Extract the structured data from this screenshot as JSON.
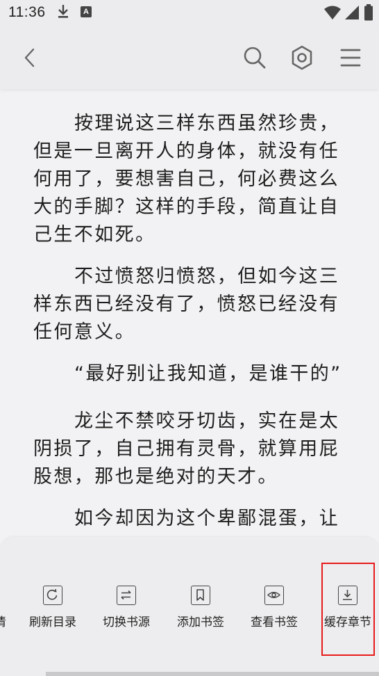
{
  "status_bar": {
    "time": "11:36",
    "app_badge": "A"
  },
  "toolbar": {
    "back": "back-icon",
    "search": "search-icon",
    "settings": "settings-icon",
    "menu": "menu-icon"
  },
  "content": {
    "paragraphs": [
      "按理说这三样东西虽然珍贵，但是一旦离开人的身体，就没有任何用了，要想害自己，何必费这么大的手脚？这样的手段，简直让自己生不如死。",
      "不过愤怒归愤怒，但如今这三样东西已经没有了，愤怒已经没有任何意义。",
      "“最好别让我知道，是谁干的”",
      "龙尘不禁咬牙切齿，实在是太阴损了，自己拥有灵骨，就算用屁股想，那也是绝对的天才。",
      "如今却因为这个卑鄙混蛋，让"
    ]
  },
  "bottom_menu": {
    "partial_label": "清",
    "items": [
      {
        "label": "刷新目录",
        "icon": "refresh-icon"
      },
      {
        "label": "切换书源",
        "icon": "swap-icon"
      },
      {
        "label": "添加书签",
        "icon": "bookmark-icon"
      },
      {
        "label": "查看书签",
        "icon": "eye-icon"
      },
      {
        "label": "缓存章节",
        "icon": "download-icon"
      }
    ]
  },
  "colors": {
    "background": "#f2f2f4",
    "text": "#1e1e1e",
    "highlight": "#e81a1a"
  }
}
